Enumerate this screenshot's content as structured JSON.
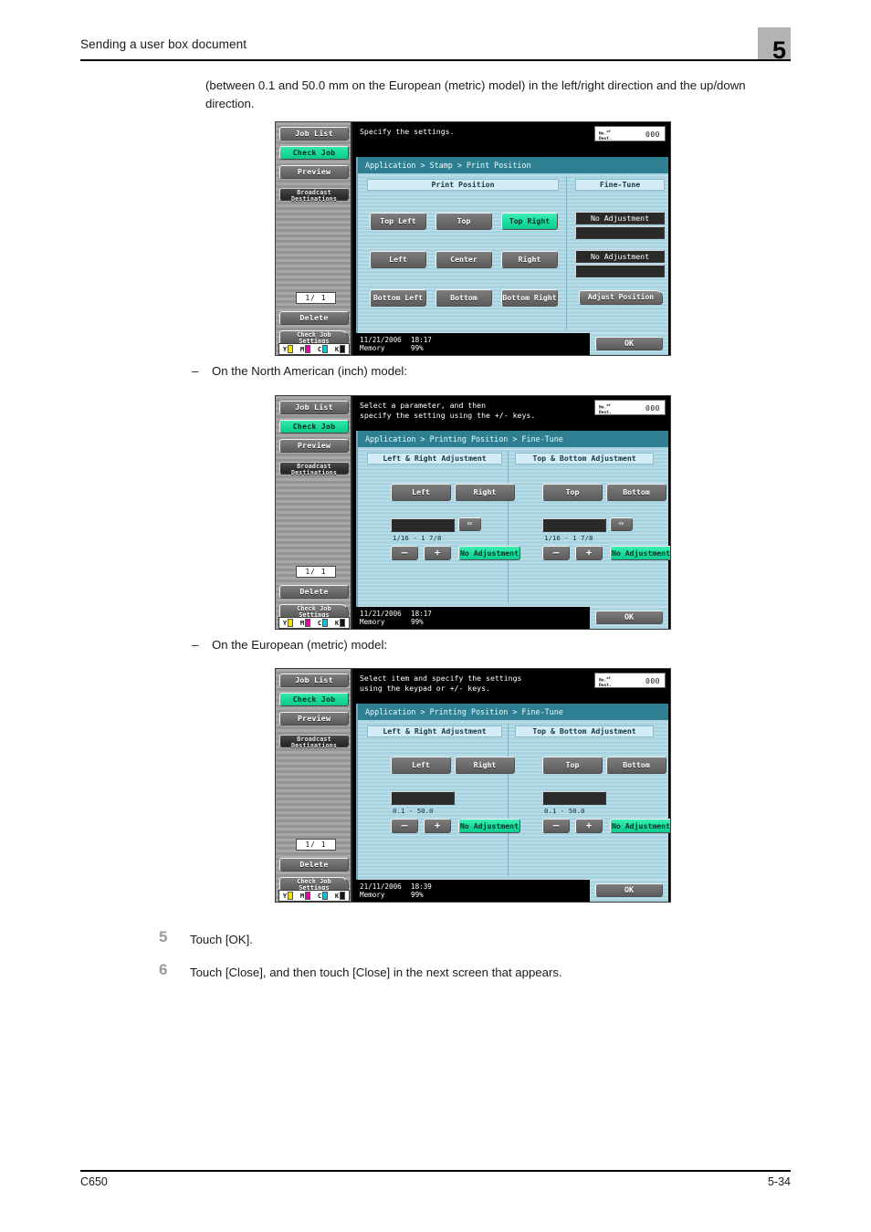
{
  "header": {
    "title": "Sending a user box document",
    "chapter": "5"
  },
  "intro": "(between 0.1 and 50.0 mm on the European (metric) model) in the left/right direction and the up/down direction.",
  "bullets": {
    "inch": "On the North American (inch) model:",
    "metric": "On the European (metric) model:"
  },
  "steps": [
    {
      "num": "5",
      "text": "Touch [OK]."
    },
    {
      "num": "6",
      "text": "Touch [Close], and then touch [Close] in the next screen that appears."
    }
  ],
  "footer": {
    "model": "C650",
    "page": "5-34"
  },
  "sidebar": {
    "job_list": "Job List",
    "check_job": "Check Job",
    "preview": "Preview",
    "broadcast_l1": "Broadcast",
    "broadcast_l2": "Destinations",
    "page_count": "1/  1",
    "delete": "Delete",
    "check_job_settings_l1": "Check Job",
    "check_job_settings_l2": "Settings",
    "toner": [
      "Y",
      "M",
      "C",
      "K"
    ],
    "toner_colors": [
      "#f2e200",
      "#ec00a8",
      "#00c8d8",
      "#111111"
    ]
  },
  "dest_box": {
    "label_l1": "No.",
    "label_l2": "Dest.",
    "label_sup": "of",
    "count": "000"
  },
  "panel1": {
    "message_l1": "Specify the settings.",
    "message_l2": "",
    "breadcrumb": "Application > Stamp > Print Position",
    "col_left_header": "Print Position",
    "col_right_header": "Fine-Tune",
    "position_buttons": [
      {
        "label": "Top Left",
        "selected": false
      },
      {
        "label": "Top",
        "selected": false
      },
      {
        "label": "Top Right",
        "selected": true
      },
      {
        "label": "Left",
        "selected": false
      },
      {
        "label": "Center",
        "selected": false
      },
      {
        "label": "Right",
        "selected": false
      },
      {
        "label": "Bottom Left",
        "selected": false
      },
      {
        "label": "Bottom",
        "selected": false
      },
      {
        "label": "Bottom Right",
        "selected": false
      }
    ],
    "fine_tune": {
      "value1": "No Adjustment",
      "field1": "",
      "value2": "No Adjustment",
      "field2": "",
      "adjust_position": "Adjust Position"
    },
    "status": {
      "date": "11/21/2006",
      "time": "18:17",
      "memory_label": "Memory",
      "memory_value": "99%"
    },
    "ok": "OK"
  },
  "panel2": {
    "message_l1": "Select a parameter, and then",
    "message_l2": "specify the setting using the +/- keys.",
    "breadcrumb": "Application > Printing Position > Fine-Tune",
    "col_left_header": "Left & Right Adjustment",
    "col_right_header": "Top & Bottom Adjustment",
    "left_group": {
      "btn_a": "Left",
      "btn_b": "Right",
      "value": "",
      "range": "1/16  -  1 7/8",
      "minus": "–",
      "plus": "+",
      "no_adjustment": "No Adjustment",
      "swap_icon": "⇔"
    },
    "right_group": {
      "btn_a": "Top",
      "btn_b": "Bottom",
      "value": "",
      "range": "1/16  -  1 7/8",
      "minus": "–",
      "plus": "+",
      "no_adjustment": "No Adjustment",
      "swap_icon": "⇔"
    },
    "status": {
      "date": "11/21/2006",
      "time": "18:17",
      "memory_label": "Memory",
      "memory_value": "99%"
    },
    "ok": "OK"
  },
  "panel3": {
    "message_l1": "Select item and specify the settings",
    "message_l2": "using the keypad or +/- keys.",
    "breadcrumb": "Application > Printing Position > Fine-Tune",
    "col_left_header": "Left & Right Adjustment",
    "col_right_header": "Top & Bottom Adjustment",
    "left_group": {
      "btn_a": "Left",
      "btn_b": "Right",
      "value": "",
      "range": "0.1  -   50.0",
      "minus": "–",
      "plus": "+",
      "no_adjustment": "No Adjustment"
    },
    "right_group": {
      "btn_a": "Top",
      "btn_b": "Bottom",
      "value": "",
      "range": "0.1  -   50.0",
      "minus": "–",
      "plus": "+",
      "no_adjustment": "No Adjustment"
    },
    "status": {
      "date": "21/11/2006",
      "time": "18:39",
      "memory_label": "Memory",
      "memory_value": "99%"
    },
    "ok": "OK"
  }
}
